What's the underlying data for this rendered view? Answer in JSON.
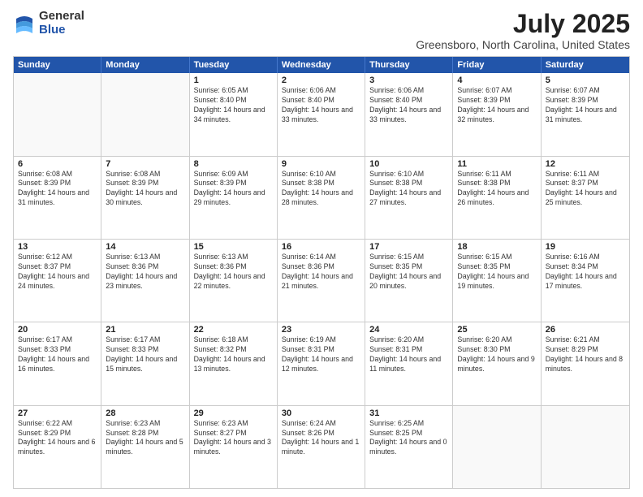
{
  "logo": {
    "general": "General",
    "blue": "Blue"
  },
  "title": "July 2025",
  "subtitle": "Greensboro, North Carolina, United States",
  "days_of_week": [
    "Sunday",
    "Monday",
    "Tuesday",
    "Wednesday",
    "Thursday",
    "Friday",
    "Saturday"
  ],
  "weeks": [
    [
      {
        "day": "",
        "sunrise": "",
        "sunset": "",
        "daylight": ""
      },
      {
        "day": "",
        "sunrise": "",
        "sunset": "",
        "daylight": ""
      },
      {
        "day": "1",
        "sunrise": "Sunrise: 6:05 AM",
        "sunset": "Sunset: 8:40 PM",
        "daylight": "Daylight: 14 hours and 34 minutes."
      },
      {
        "day": "2",
        "sunrise": "Sunrise: 6:06 AM",
        "sunset": "Sunset: 8:40 PM",
        "daylight": "Daylight: 14 hours and 33 minutes."
      },
      {
        "day": "3",
        "sunrise": "Sunrise: 6:06 AM",
        "sunset": "Sunset: 8:40 PM",
        "daylight": "Daylight: 14 hours and 33 minutes."
      },
      {
        "day": "4",
        "sunrise": "Sunrise: 6:07 AM",
        "sunset": "Sunset: 8:39 PM",
        "daylight": "Daylight: 14 hours and 32 minutes."
      },
      {
        "day": "5",
        "sunrise": "Sunrise: 6:07 AM",
        "sunset": "Sunset: 8:39 PM",
        "daylight": "Daylight: 14 hours and 31 minutes."
      }
    ],
    [
      {
        "day": "6",
        "sunrise": "Sunrise: 6:08 AM",
        "sunset": "Sunset: 8:39 PM",
        "daylight": "Daylight: 14 hours and 31 minutes."
      },
      {
        "day": "7",
        "sunrise": "Sunrise: 6:08 AM",
        "sunset": "Sunset: 8:39 PM",
        "daylight": "Daylight: 14 hours and 30 minutes."
      },
      {
        "day": "8",
        "sunrise": "Sunrise: 6:09 AM",
        "sunset": "Sunset: 8:39 PM",
        "daylight": "Daylight: 14 hours and 29 minutes."
      },
      {
        "day": "9",
        "sunrise": "Sunrise: 6:10 AM",
        "sunset": "Sunset: 8:38 PM",
        "daylight": "Daylight: 14 hours and 28 minutes."
      },
      {
        "day": "10",
        "sunrise": "Sunrise: 6:10 AM",
        "sunset": "Sunset: 8:38 PM",
        "daylight": "Daylight: 14 hours and 27 minutes."
      },
      {
        "day": "11",
        "sunrise": "Sunrise: 6:11 AM",
        "sunset": "Sunset: 8:38 PM",
        "daylight": "Daylight: 14 hours and 26 minutes."
      },
      {
        "day": "12",
        "sunrise": "Sunrise: 6:11 AM",
        "sunset": "Sunset: 8:37 PM",
        "daylight": "Daylight: 14 hours and 25 minutes."
      }
    ],
    [
      {
        "day": "13",
        "sunrise": "Sunrise: 6:12 AM",
        "sunset": "Sunset: 8:37 PM",
        "daylight": "Daylight: 14 hours and 24 minutes."
      },
      {
        "day": "14",
        "sunrise": "Sunrise: 6:13 AM",
        "sunset": "Sunset: 8:36 PM",
        "daylight": "Daylight: 14 hours and 23 minutes."
      },
      {
        "day": "15",
        "sunrise": "Sunrise: 6:13 AM",
        "sunset": "Sunset: 8:36 PM",
        "daylight": "Daylight: 14 hours and 22 minutes."
      },
      {
        "day": "16",
        "sunrise": "Sunrise: 6:14 AM",
        "sunset": "Sunset: 8:36 PM",
        "daylight": "Daylight: 14 hours and 21 minutes."
      },
      {
        "day": "17",
        "sunrise": "Sunrise: 6:15 AM",
        "sunset": "Sunset: 8:35 PM",
        "daylight": "Daylight: 14 hours and 20 minutes."
      },
      {
        "day": "18",
        "sunrise": "Sunrise: 6:15 AM",
        "sunset": "Sunset: 8:35 PM",
        "daylight": "Daylight: 14 hours and 19 minutes."
      },
      {
        "day": "19",
        "sunrise": "Sunrise: 6:16 AM",
        "sunset": "Sunset: 8:34 PM",
        "daylight": "Daylight: 14 hours and 17 minutes."
      }
    ],
    [
      {
        "day": "20",
        "sunrise": "Sunrise: 6:17 AM",
        "sunset": "Sunset: 8:33 PM",
        "daylight": "Daylight: 14 hours and 16 minutes."
      },
      {
        "day": "21",
        "sunrise": "Sunrise: 6:17 AM",
        "sunset": "Sunset: 8:33 PM",
        "daylight": "Daylight: 14 hours and 15 minutes."
      },
      {
        "day": "22",
        "sunrise": "Sunrise: 6:18 AM",
        "sunset": "Sunset: 8:32 PM",
        "daylight": "Daylight: 14 hours and 13 minutes."
      },
      {
        "day": "23",
        "sunrise": "Sunrise: 6:19 AM",
        "sunset": "Sunset: 8:31 PM",
        "daylight": "Daylight: 14 hours and 12 minutes."
      },
      {
        "day": "24",
        "sunrise": "Sunrise: 6:20 AM",
        "sunset": "Sunset: 8:31 PM",
        "daylight": "Daylight: 14 hours and 11 minutes."
      },
      {
        "day": "25",
        "sunrise": "Sunrise: 6:20 AM",
        "sunset": "Sunset: 8:30 PM",
        "daylight": "Daylight: 14 hours and 9 minutes."
      },
      {
        "day": "26",
        "sunrise": "Sunrise: 6:21 AM",
        "sunset": "Sunset: 8:29 PM",
        "daylight": "Daylight: 14 hours and 8 minutes."
      }
    ],
    [
      {
        "day": "27",
        "sunrise": "Sunrise: 6:22 AM",
        "sunset": "Sunset: 8:29 PM",
        "daylight": "Daylight: 14 hours and 6 minutes."
      },
      {
        "day": "28",
        "sunrise": "Sunrise: 6:23 AM",
        "sunset": "Sunset: 8:28 PM",
        "daylight": "Daylight: 14 hours and 5 minutes."
      },
      {
        "day": "29",
        "sunrise": "Sunrise: 6:23 AM",
        "sunset": "Sunset: 8:27 PM",
        "daylight": "Daylight: 14 hours and 3 minutes."
      },
      {
        "day": "30",
        "sunrise": "Sunrise: 6:24 AM",
        "sunset": "Sunset: 8:26 PM",
        "daylight": "Daylight: 14 hours and 1 minute."
      },
      {
        "day": "31",
        "sunrise": "Sunrise: 6:25 AM",
        "sunset": "Sunset: 8:25 PM",
        "daylight": "Daylight: 14 hours and 0 minutes."
      },
      {
        "day": "",
        "sunrise": "",
        "sunset": "",
        "daylight": ""
      },
      {
        "day": "",
        "sunrise": "",
        "sunset": "",
        "daylight": ""
      }
    ]
  ]
}
